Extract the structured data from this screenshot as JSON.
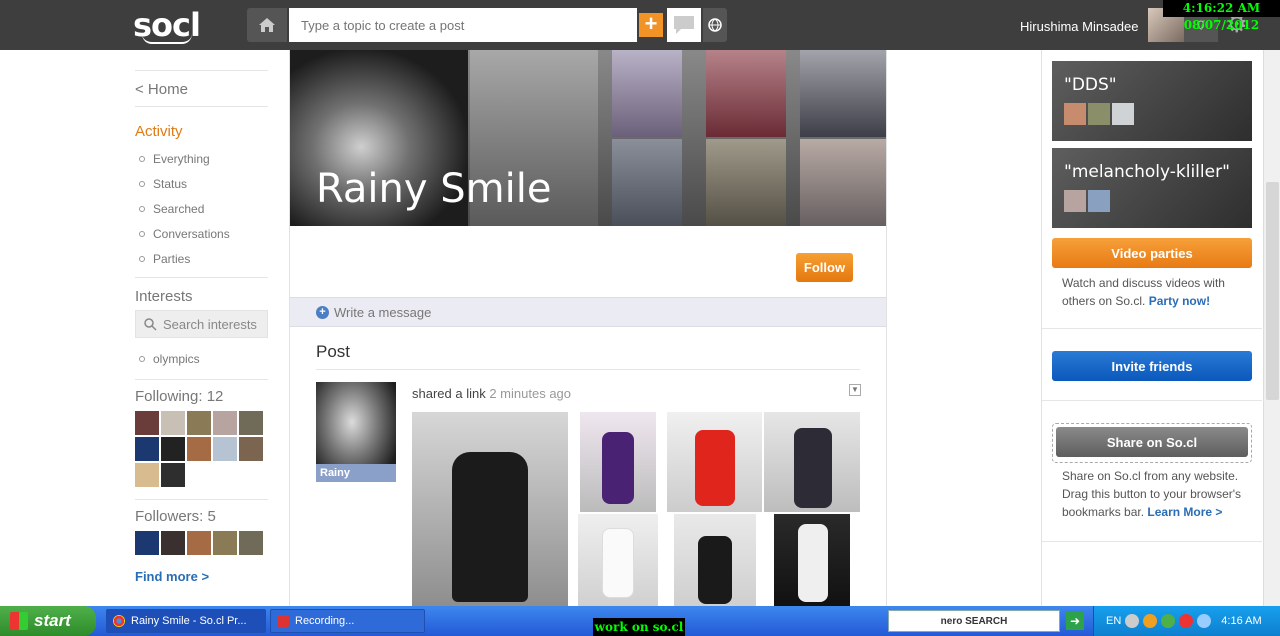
{
  "header": {
    "logo": "socl",
    "search_placeholder": "Type a topic to create a post",
    "username": "Hirushima Minsadee",
    "notification_count": "0",
    "clock": "4:16:22 AM 08/07/2012"
  },
  "leftnav": {
    "home": "< Home",
    "activity_heading": "Activity",
    "activity_items": [
      "Everything",
      "Status",
      "Searched",
      "Conversations",
      "Parties"
    ],
    "interests_heading": "Interests",
    "interests_search_placeholder": "Search interests",
    "interests": [
      "olympics"
    ],
    "following_label": "Following: 12",
    "followers_label": "Followers: 5",
    "find_more": "Find more >"
  },
  "profile": {
    "name": "Rainy Smile",
    "follow_label": "Follow",
    "write_message": "Write a message",
    "post_heading": "Post"
  },
  "post": {
    "author_label": "Rainy",
    "action": "shared a link",
    "time": "2 minutes ago"
  },
  "right": {
    "parties": [
      {
        "name": "\"DDS\""
      },
      {
        "name": "\"melancholy-kliller\""
      }
    ],
    "video_parties_label": "Video parties",
    "video_parties_desc": "Watch and discuss videos with others on So.cl.",
    "party_now_link": "Party now!",
    "invite_label": "Invite friends",
    "share_label": "Share on So.cl",
    "share_desc": "Share on So.cl from any website. Drag this button to your browser's bookmarks bar.",
    "learn_more_link": "Learn More >"
  },
  "taskbar": {
    "start": "start",
    "tasks": [
      "Rainy Smile - So.cl Pr...",
      "Recording..."
    ],
    "overlay_label": "work on so.cl",
    "nero_label": "nero SEARCH",
    "language": "EN",
    "time": "4:16 AM"
  },
  "colors": {
    "accent_orange": "#f29325",
    "link_blue": "#2a6db5",
    "topbar": "#3e3e3e"
  }
}
